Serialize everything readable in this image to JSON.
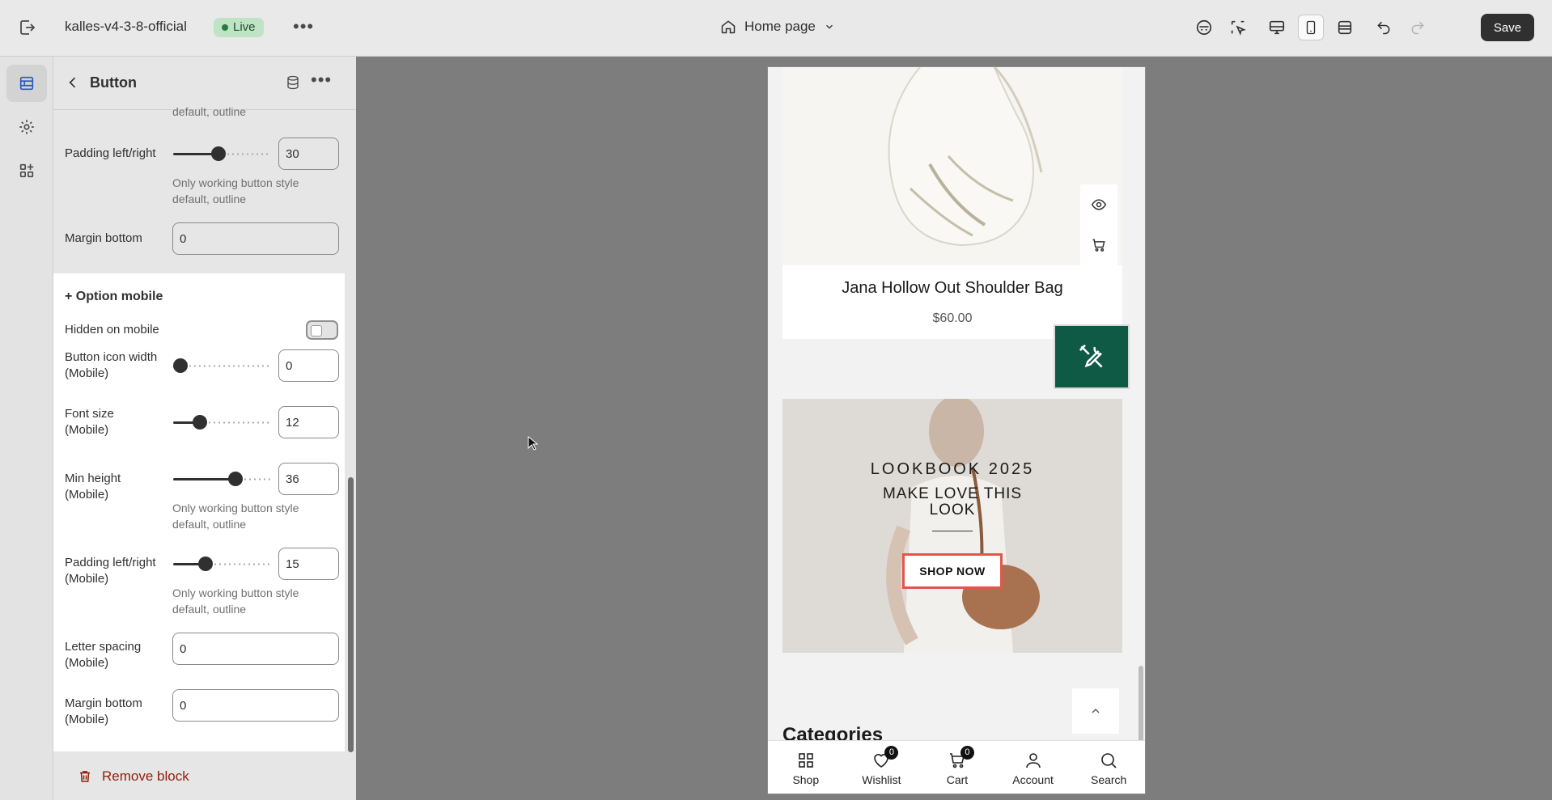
{
  "topbar": {
    "store_name": "kalles-v4-3-8-official",
    "live_label": "Live",
    "page_select_label": "Home page",
    "save_label": "Save"
  },
  "panel": {
    "title": "Button",
    "partial_help_top": "default, outline",
    "padding_lr": {
      "label": "Padding left/right",
      "value": "30",
      "help_1": "Only working button style",
      "help_2": "default, outline",
      "level": 0.46
    },
    "margin_bottom": {
      "label": "Margin bottom",
      "value": "0"
    },
    "option_mobile": {
      "title": "+ Option mobile",
      "hidden_on_mobile": {
        "label": "Hidden on mobile",
        "checked": false
      },
      "button_icon_width": {
        "label_1": "Button icon width",
        "label_2": "(Mobile)",
        "value": "0",
        "level": 0
      },
      "font_size": {
        "label_1": "Font size",
        "label_2": "(Mobile)",
        "value": "12",
        "level": 0.24
      },
      "min_height": {
        "label_1": "Min height",
        "label_2": "(Mobile)",
        "value": "36",
        "level": 0.67,
        "help_1": "Only working button style",
        "help_2": "default, outline"
      },
      "padding_lr": {
        "label_1": "Padding left/right",
        "label_2": "(Mobile)",
        "value": "15",
        "level": 0.3,
        "help_1": "Only working button style",
        "help_2": "default, outline"
      },
      "letter_spacing": {
        "label_1": "Letter spacing",
        "label_2": "(Mobile)",
        "value": "0"
      },
      "margin_bottom": {
        "label_1": "Margin bottom",
        "label_2": "(Mobile)",
        "value": "0"
      }
    },
    "remove_block_label": "Remove block"
  },
  "preview": {
    "product_name": "Jana Hollow Out Shoulder Bag",
    "product_price": "$60.00",
    "lookbook_title": "LOOKBOOK 2025",
    "lookbook_subtitle": "MAKE LOVE THIS LOOK",
    "shop_now_label": "SHOP NOW",
    "categories_heading": "Categories",
    "bottom_nav": [
      {
        "label": "Shop",
        "icon": "grid-icon"
      },
      {
        "label": "Wishlist",
        "icon": "heart-icon",
        "badge": "0"
      },
      {
        "label": "Cart",
        "icon": "cart-icon",
        "badge": "0"
      },
      {
        "label": "Account",
        "icon": "user-icon"
      },
      {
        "label": "Search",
        "icon": "search-icon"
      }
    ]
  },
  "colors": {
    "accent_green": "#0e5a45",
    "live_badge": "#bfe3c5",
    "remove_red": "#8e1f0b",
    "selection_outline": "#e4564b"
  }
}
